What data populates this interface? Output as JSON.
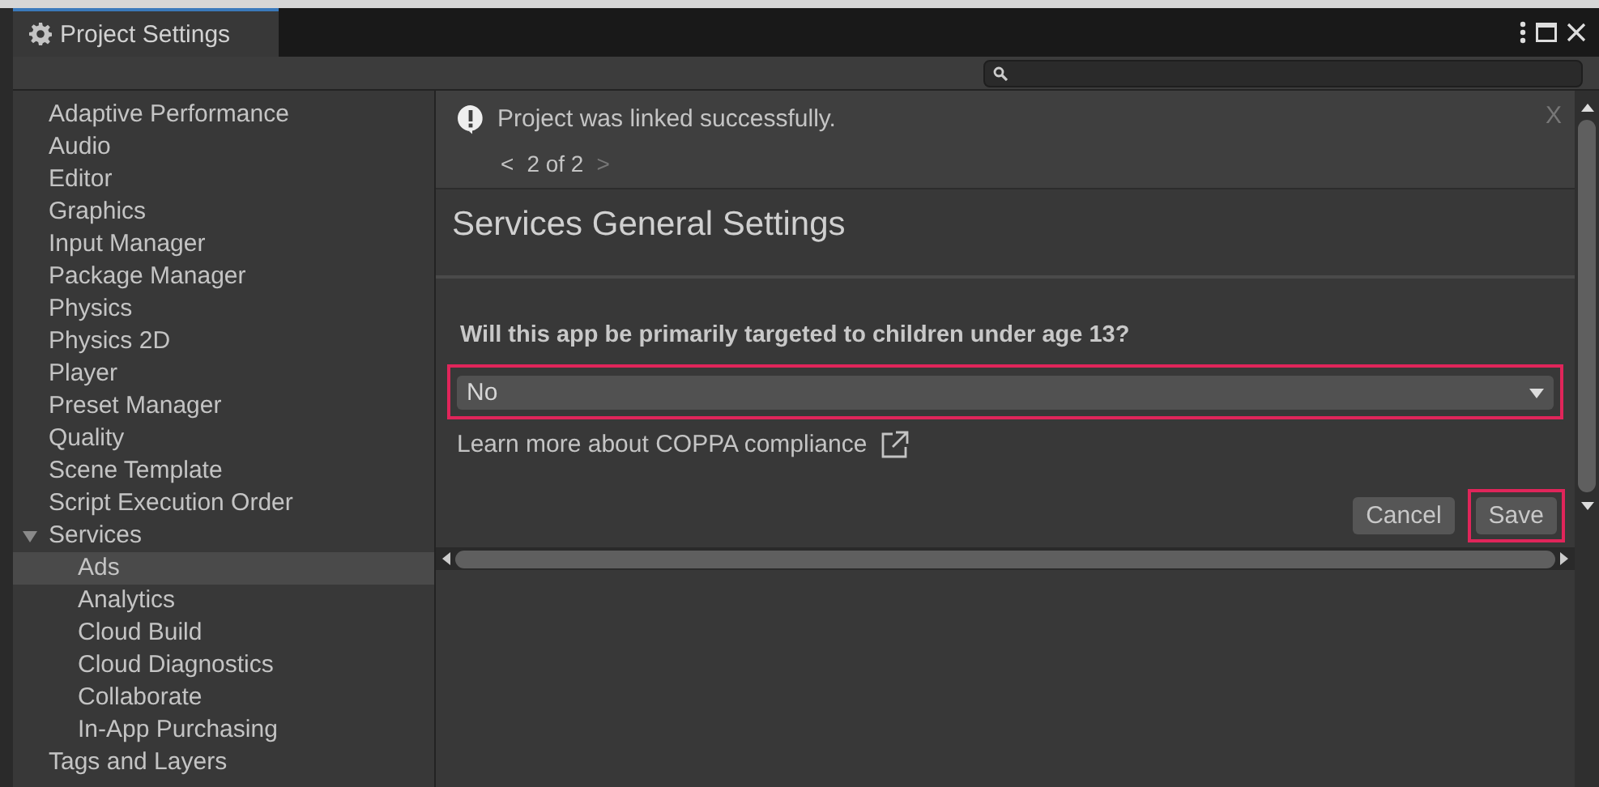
{
  "window": {
    "title": "Project Settings"
  },
  "sidebar": {
    "items": [
      {
        "label": "Adaptive Performance",
        "selected": false
      },
      {
        "label": "Audio",
        "selected": false
      },
      {
        "label": "Editor",
        "selected": false
      },
      {
        "label": "Graphics",
        "selected": false
      },
      {
        "label": "Input Manager",
        "selected": false
      },
      {
        "label": "Package Manager",
        "selected": false
      },
      {
        "label": "Physics",
        "selected": false
      },
      {
        "label": "Physics 2D",
        "selected": false
      },
      {
        "label": "Player",
        "selected": false
      },
      {
        "label": "Preset Manager",
        "selected": false
      },
      {
        "label": "Quality",
        "selected": false
      },
      {
        "label": "Scene Template",
        "selected": false
      },
      {
        "label": "Script Execution Order",
        "selected": false
      },
      {
        "label": "Services",
        "selected": false,
        "expanded": true,
        "children": [
          {
            "label": "Ads",
            "selected": true
          },
          {
            "label": "Analytics",
            "selected": false
          },
          {
            "label": "Cloud Build",
            "selected": false
          },
          {
            "label": "Cloud Diagnostics",
            "selected": false
          },
          {
            "label": "Collaborate",
            "selected": false
          },
          {
            "label": "In-App Purchasing",
            "selected": false
          }
        ]
      },
      {
        "label": "Tags and Layers",
        "selected": false
      }
    ]
  },
  "notification": {
    "message": "Project was linked successfully.",
    "pager": {
      "prev": "<",
      "page": "2 of 2",
      "next": ">",
      "next_disabled": true
    },
    "close": "X"
  },
  "section": {
    "title": "Services General Settings",
    "question": "Will this app be primarily targeted to children under age 13?",
    "dropdown": {
      "value": "No",
      "highlighted": true
    },
    "link": "Learn more about COPPA compliance",
    "buttons": [
      {
        "label": "Cancel",
        "highlighted": false
      },
      {
        "label": "Save",
        "highlighted": true
      }
    ]
  }
}
